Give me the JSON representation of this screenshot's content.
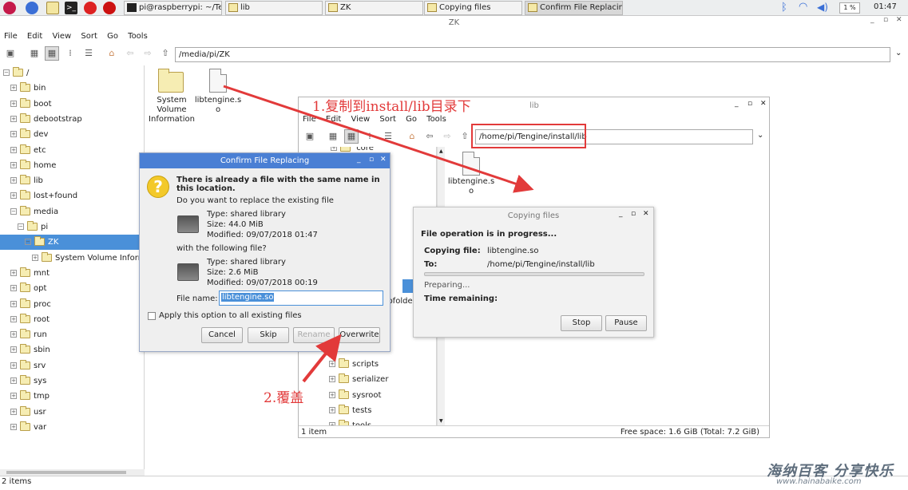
{
  "taskbar": {
    "tasks": [
      {
        "label": "pi@raspberrypi: ~/Te..."
      },
      {
        "label": "lib"
      },
      {
        "label": "ZK"
      },
      {
        "label": "Copying files"
      },
      {
        "label": "Confirm File Replacing"
      }
    ],
    "cpu": "1 %",
    "clock": "01:47"
  },
  "main_window": {
    "title": "ZK",
    "menu": [
      "File",
      "Edit",
      "View",
      "Sort",
      "Go",
      "Tools"
    ],
    "path": "/media/pi/ZK",
    "tree": [
      {
        "label": "/",
        "expander": "⊟",
        "indent": 0
      },
      {
        "label": "bin",
        "expander": "⊞",
        "indent": 1
      },
      {
        "label": "boot",
        "expander": "⊞",
        "indent": 1
      },
      {
        "label": "debootstrap",
        "expander": "⊞",
        "indent": 1
      },
      {
        "label": "dev",
        "expander": "⊞",
        "indent": 1
      },
      {
        "label": "etc",
        "expander": "⊞",
        "indent": 1
      },
      {
        "label": "home",
        "expander": "⊞",
        "indent": 1
      },
      {
        "label": "lib",
        "expander": "⊞",
        "indent": 1
      },
      {
        "label": "lost+found",
        "expander": "⊞",
        "indent": 1
      },
      {
        "label": "media",
        "expander": "⊟",
        "indent": 1
      },
      {
        "label": "pi",
        "expander": "⊟",
        "indent": 2
      },
      {
        "label": "ZK",
        "expander": "⊟",
        "indent": 3,
        "selected": true
      },
      {
        "label": "System Volume Informat",
        "expander": "⊞",
        "indent": 4
      },
      {
        "label": "mnt",
        "expander": "⊞",
        "indent": 1
      },
      {
        "label": "opt",
        "expander": "⊞",
        "indent": 1
      },
      {
        "label": "proc",
        "expander": "⊞",
        "indent": 1
      },
      {
        "label": "root",
        "expander": "⊞",
        "indent": 1
      },
      {
        "label": "run",
        "expander": "⊞",
        "indent": 1
      },
      {
        "label": "sbin",
        "expander": "⊞",
        "indent": 1
      },
      {
        "label": "srv",
        "expander": "⊞",
        "indent": 1
      },
      {
        "label": "sys",
        "expander": "⊞",
        "indent": 1
      },
      {
        "label": "tmp",
        "expander": "⊞",
        "indent": 1
      },
      {
        "label": "usr",
        "expander": "⊞",
        "indent": 1
      },
      {
        "label": "var",
        "expander": "⊞",
        "indent": 1
      }
    ],
    "files": [
      {
        "label_lines": [
          "System",
          "Volume",
          "Information"
        ]
      },
      {
        "label_lines": [
          "libtengine.s",
          "o"
        ]
      }
    ],
    "status": "2 items"
  },
  "lib_window": {
    "title": "lib",
    "menu": [
      "File",
      "Edit",
      "View",
      "Sort",
      "Go",
      "Tools"
    ],
    "path": "/home/pi/Tengine/install/lib",
    "tree_top": "core",
    "tree_partial": "ubfolde",
    "tree": [
      "scripts",
      "serializer",
      "sysroot",
      "tests",
      "tools"
    ],
    "file_label_lines": [
      "libtengine.s",
      "o"
    ],
    "status_left": "1 item",
    "status_right": "Free space: 1.6 GiB (Total: 7.2 GiB)"
  },
  "copy_dialog": {
    "title": "Copying files",
    "heading": "File operation is in progress...",
    "copying_label": "Copying file:",
    "copying_value": "libtengine.so",
    "to_label": "To:",
    "to_value": "/home/pi/Tengine/install/lib",
    "progress_fraction": 0,
    "preparing": "Preparing...",
    "time_label": "Time remaining:",
    "stop": "Stop",
    "pause": "Pause"
  },
  "replace_dialog": {
    "title": "Confirm File Replacing",
    "heading": "There is already a file with the same name in this location.",
    "question": "Do you want to replace the existing file",
    "existing": {
      "type": "Type: shared library",
      "size": "Size: 44.0 MiB",
      "modified": "Modified: 09/07/2018 01:47"
    },
    "with": "with the following file?",
    "new": {
      "type": "Type: shared library",
      "size": "Size: 2.6 MiB",
      "modified": "Modified: 09/07/2018 00:19"
    },
    "filename_label": "File name:",
    "filename_value": "libtengine.so",
    "apply_all": "Apply this option to all existing files",
    "cancel": "Cancel",
    "skip": "Skip",
    "rename": "Rename",
    "overwrite": "Overwrite"
  },
  "annotations": {
    "step1": "1.复制到install/lib目录下",
    "step2": "2.覆盖"
  },
  "watermark": "海纳百客 分享快乐",
  "watermark_url": "www.hainabaike.com",
  "colors": {
    "selection": "#4a90d9",
    "annotation": "#e23a3a",
    "dialog_title": "#4a7fd4"
  }
}
